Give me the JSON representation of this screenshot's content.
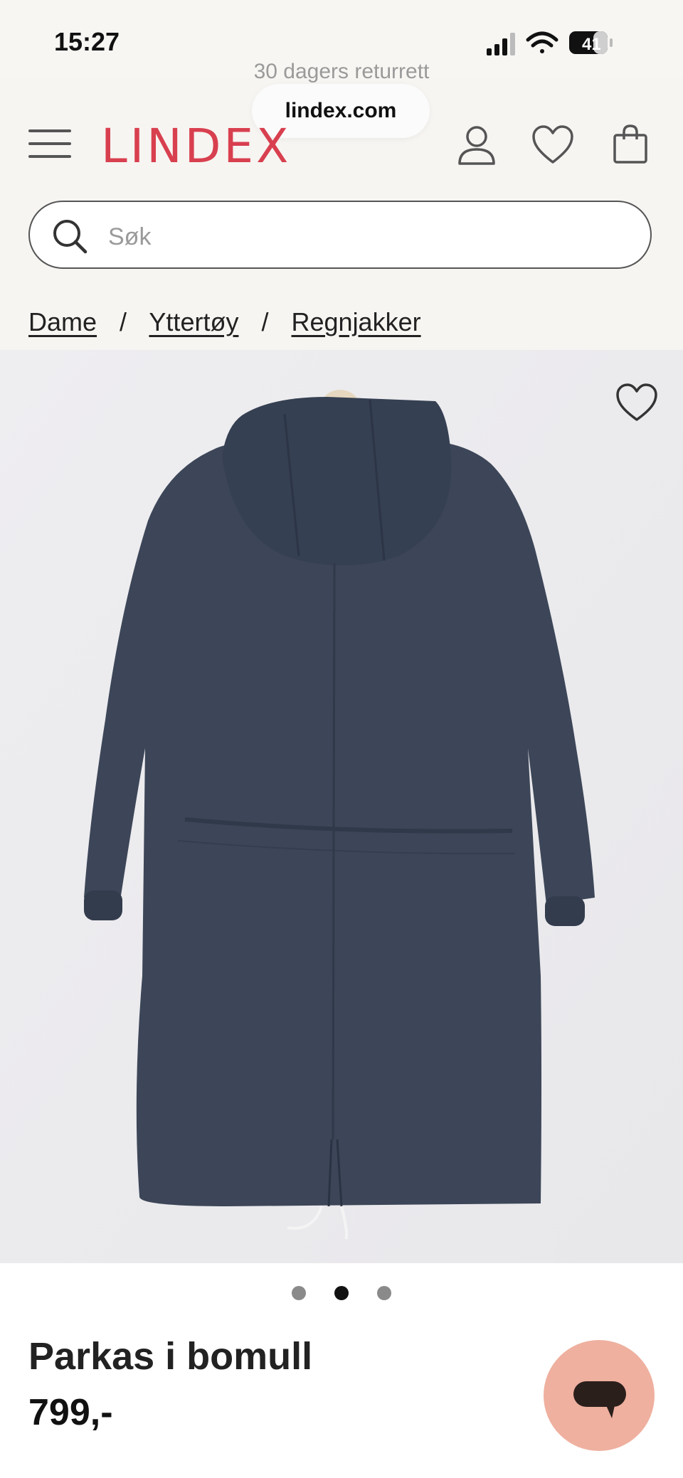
{
  "status_bar": {
    "time": "15:27",
    "battery": "41"
  },
  "header": {
    "promo": "30 dagers returrett",
    "url": "lindex.com",
    "brand": "LINDEX",
    "brand_color": "#d8404f"
  },
  "search": {
    "placeholder": "Søk"
  },
  "breadcrumb": {
    "items": [
      "Dame",
      "Yttertøy",
      "Regnjakker"
    ],
    "separator": "/"
  },
  "gallery": {
    "total_images": 3,
    "active_index": 1
  },
  "product": {
    "title": "Parkas i bomull",
    "price": "799,-"
  },
  "icons": {
    "menu": "hamburger-icon",
    "account": "user-icon",
    "wishlist": "heart-icon",
    "cart": "bag-icon",
    "search": "search-icon",
    "chat": "chat-bubble-icon"
  }
}
